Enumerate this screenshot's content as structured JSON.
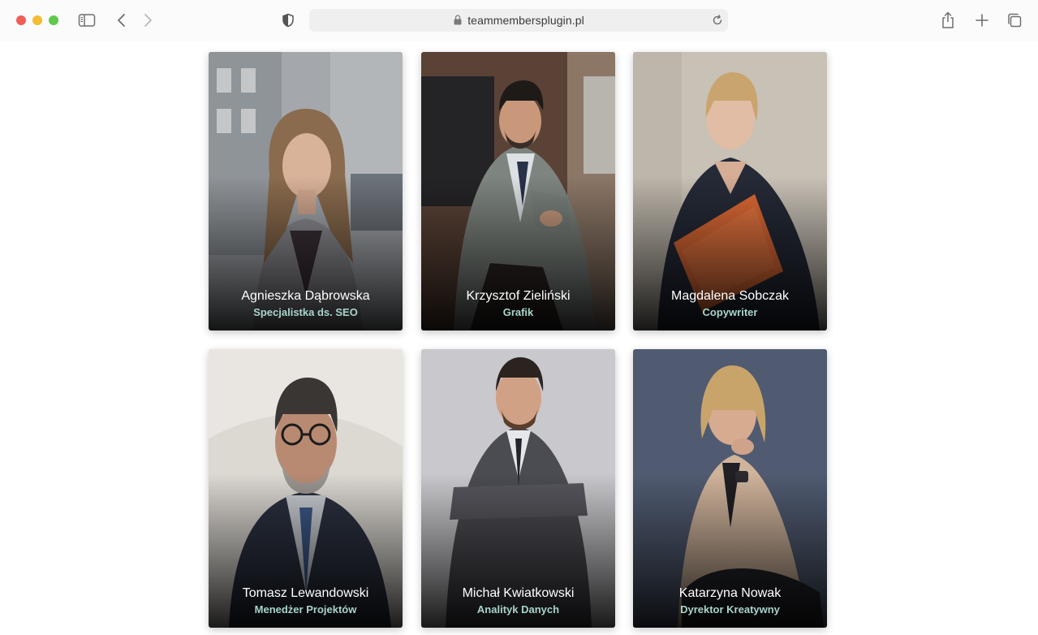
{
  "browser": {
    "url": "teammembersplugin.pl",
    "icons": [
      "sidebar-icon",
      "back-icon",
      "forward-icon",
      "shield-icon",
      "lock-icon",
      "reload-icon",
      "share-icon",
      "new-tab-icon",
      "tabs-overview-icon"
    ]
  },
  "team": {
    "members": [
      {
        "name": "Agnieszka Dąbrowska",
        "role": "Specjalistka ds. SEO"
      },
      {
        "name": "Krzysztof Zieliński",
        "role": "Grafik"
      },
      {
        "name": "Magdalena Sobczak",
        "role": "Copywriter"
      },
      {
        "name": "Tomasz Lewandowski",
        "role": "Menedżer Projektów"
      },
      {
        "name": "Michał Kwiatkowski",
        "role": "Analityk Danych"
      },
      {
        "name": "Katarzyna Nowak",
        "role": "Dyrektor Kreatywny"
      }
    ]
  },
  "colors": {
    "role_text": "#a8d4cc",
    "name_text": "#ffffff",
    "toolbar_bg": "#fbfbfb",
    "urlbar_bg": "#efefef"
  }
}
